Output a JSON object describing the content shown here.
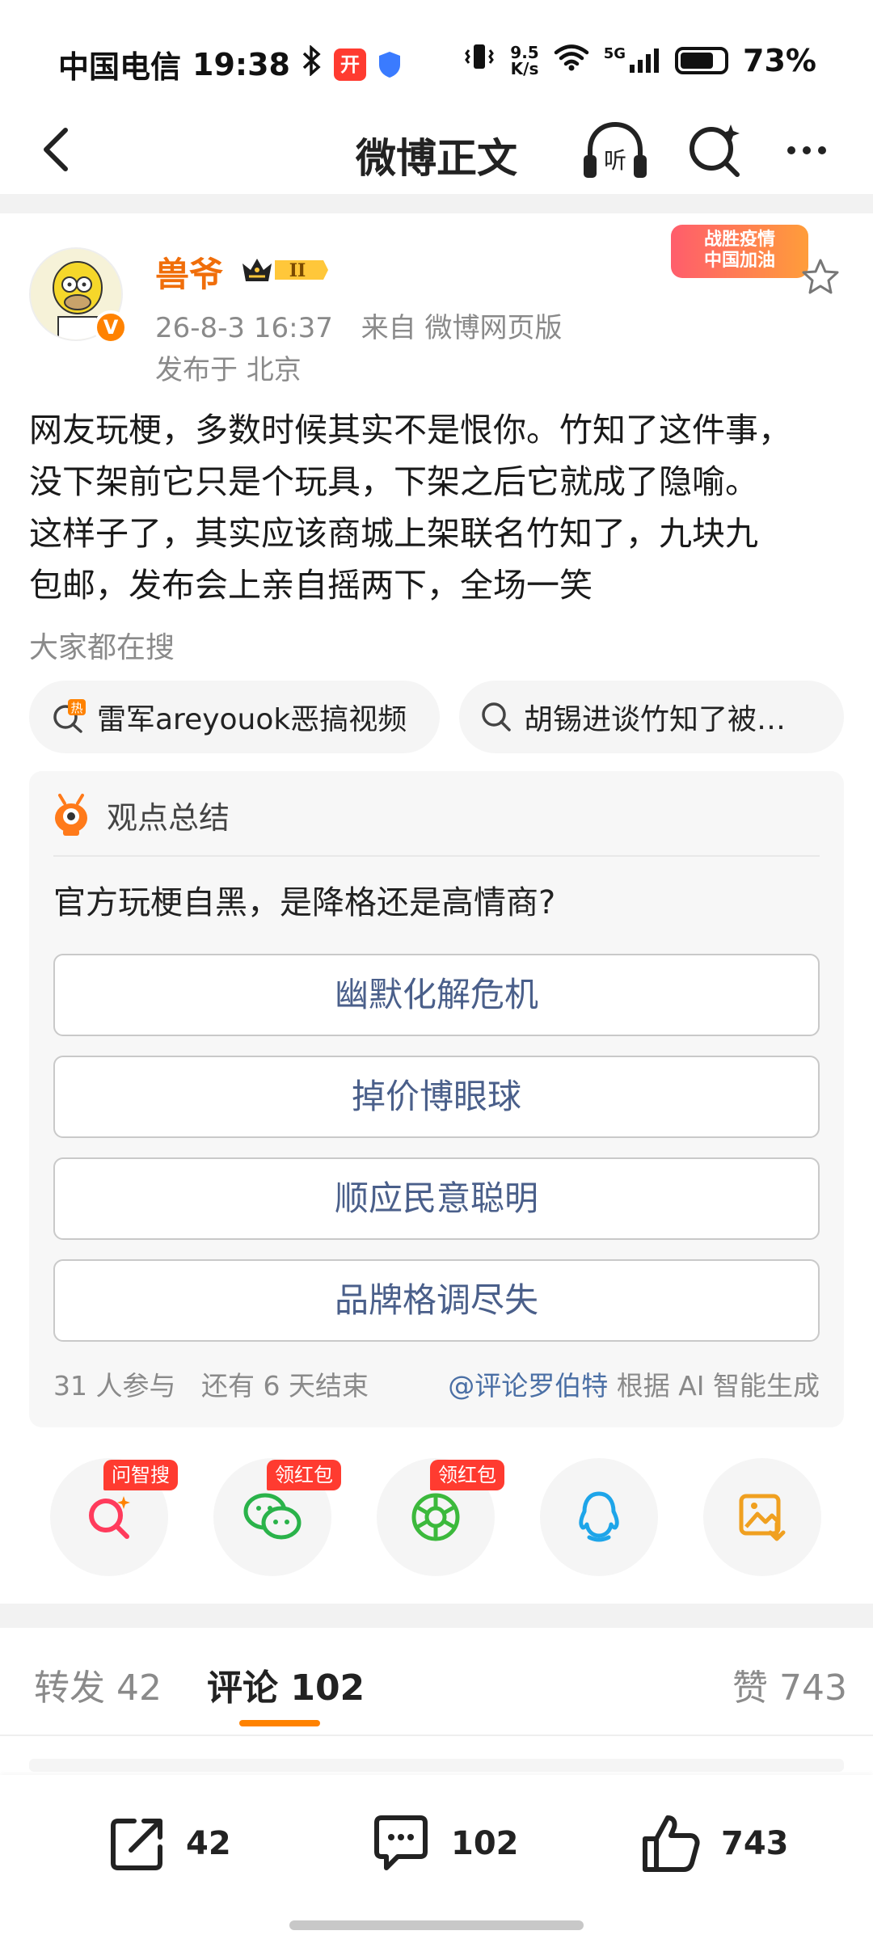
{
  "status_bar": {
    "carrier": "中国电信",
    "time": "19:38",
    "badge_open": "开",
    "net_speed_top": "9.5",
    "net_speed_bottom": "K/s",
    "network": "5G",
    "battery": "73%"
  },
  "nav": {
    "title": "微博正文",
    "listen_label": "听"
  },
  "post": {
    "username": "兽爷",
    "vip_level": "II",
    "timestamp": "26-8-3 16:37",
    "source": "来自 微博网页版",
    "location": "发布于 北京",
    "verified_mark": "V",
    "campaign_line1": "战胜疫情",
    "campaign_line2": "中国加油",
    "body_lines": [
      "网友玩梗，多数时候其实不是恨你。竹知了这件事，",
      "没下架前它只是个玩具，下架之后它就成了隐喻。",
      "这样子了，其实应该商城上架联名竹知了，九块九",
      "包邮，发布会上亲自摇两下，全场一笑"
    ]
  },
  "trending": {
    "label": "大家都在搜",
    "hot_mark": "热",
    "items": [
      "雷军areyouok恶搞视频",
      "胡锡进谈竹知了被…"
    ]
  },
  "poll": {
    "header": "观点总结",
    "question": "官方玩梗自黑，是降格还是高情商?",
    "options": [
      "幽默化解危机",
      "掉价博眼球",
      "顺应民意聪明",
      "品牌格调尽失"
    ],
    "participants": "31 人参与",
    "remaining": "还有 6 天结束",
    "generator_account": "@评论罗伯特",
    "generator_note": "根据 AI 智能生成"
  },
  "share": {
    "tags": [
      "问智搜",
      "领红包",
      "领红包"
    ],
    "icons": [
      "search-ai-icon",
      "wechat-icon",
      "moments-icon",
      "qq-icon",
      "save-image-icon"
    ]
  },
  "tabs": {
    "repost_label": "转发",
    "repost_count": "42",
    "comment_label": "评论",
    "comment_count": "102",
    "like_label": "赞",
    "like_count": "743"
  },
  "bottom_bar": {
    "repost_count": "42",
    "comment_count": "102",
    "like_count": "743"
  },
  "colors": {
    "accent_orange": "#ff8200",
    "username_orange": "#f06e0a",
    "link_blue": "#4a6fa5",
    "tag_red": "#ff3b30"
  }
}
